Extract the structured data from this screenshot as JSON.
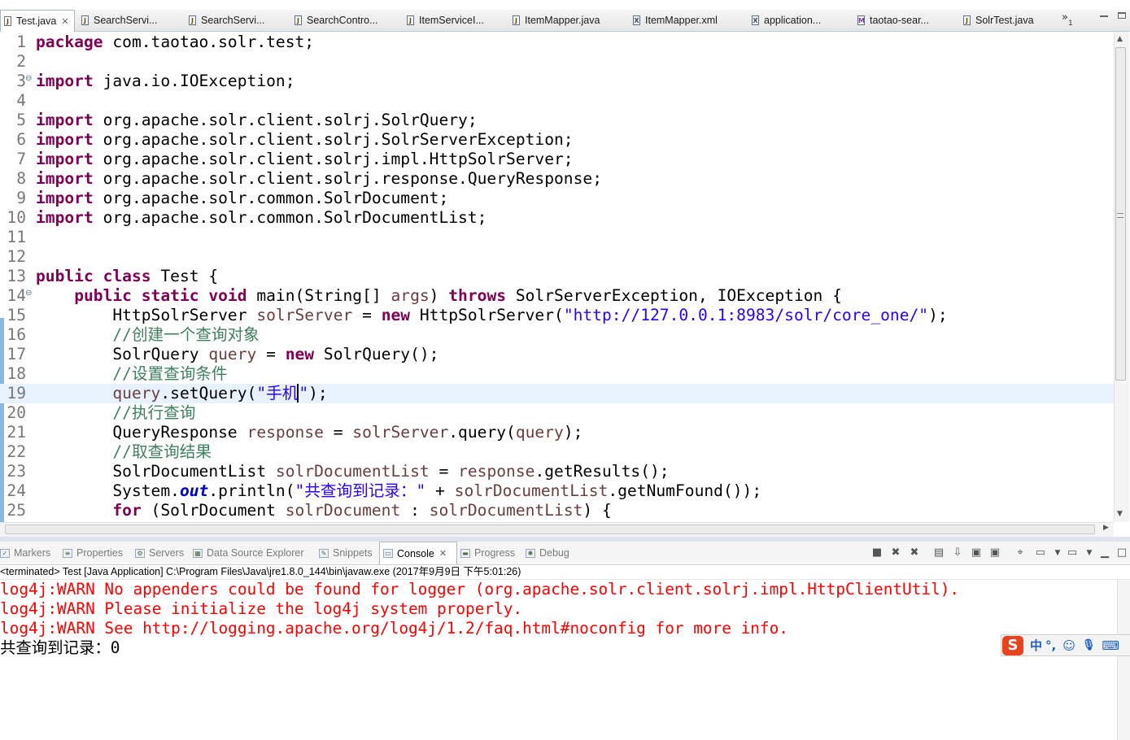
{
  "editor_tabs": [
    {
      "label": "Test.java",
      "icon": "J",
      "active": true
    },
    {
      "label": "SearchServi...",
      "icon": "J"
    },
    {
      "label": "SearchServi...",
      "icon": "J"
    },
    {
      "label": "SearchContro...",
      "icon": "J"
    },
    {
      "label": "ItemServiceI...",
      "icon": "J"
    },
    {
      "label": "ItemMapper.java",
      "icon": "J"
    },
    {
      "label": "ItemMapper.xml",
      "icon": "X"
    },
    {
      "label": "application...",
      "icon": "X"
    },
    {
      "label": "taotao-sear...",
      "icon": "M"
    },
    {
      "label": "SolrTest.java",
      "icon": "J"
    }
  ],
  "more_tabs": {
    "symbol": "»",
    "count": "1"
  },
  "code_lines": [
    {
      "n": "1",
      "tokens": [
        {
          "t": "package",
          "c": "kw"
        },
        {
          "t": " com.taotao.solr.test;"
        }
      ]
    },
    {
      "n": "2",
      "tokens": []
    },
    {
      "n": "3",
      "fold": true,
      "tokens": [
        {
          "t": "import",
          "c": "kw"
        },
        {
          "t": " java.io.IOException;"
        }
      ]
    },
    {
      "n": "4",
      "tokens": []
    },
    {
      "n": "5",
      "tokens": [
        {
          "t": "import",
          "c": "kw"
        },
        {
          "t": " org.apache.solr.client.solrj.SolrQuery;"
        }
      ]
    },
    {
      "n": "6",
      "tokens": [
        {
          "t": "import",
          "c": "kw"
        },
        {
          "t": " org.apache.solr.client.solrj.SolrServerException;"
        }
      ]
    },
    {
      "n": "7",
      "tokens": [
        {
          "t": "import",
          "c": "kw"
        },
        {
          "t": " org.apache.solr.client.solrj.impl.HttpSolrServer;"
        }
      ]
    },
    {
      "n": "8",
      "tokens": [
        {
          "t": "import",
          "c": "kw"
        },
        {
          "t": " org.apache.solr.client.solrj.response.QueryResponse;"
        }
      ]
    },
    {
      "n": "9",
      "tokens": [
        {
          "t": "import",
          "c": "kw"
        },
        {
          "t": " org.apache.solr.common.SolrDocument;"
        }
      ]
    },
    {
      "n": "10",
      "tokens": [
        {
          "t": "import",
          "c": "kw"
        },
        {
          "t": " org.apache.solr.common.SolrDocumentList;"
        }
      ]
    },
    {
      "n": "11",
      "tokens": []
    },
    {
      "n": "12",
      "tokens": []
    },
    {
      "n": "13",
      "tokens": [
        {
          "t": "public",
          "c": "kw"
        },
        {
          "t": " "
        },
        {
          "t": "class",
          "c": "kw"
        },
        {
          "t": " Test {"
        }
      ]
    },
    {
      "n": "14",
      "fold": true,
      "tokens": [
        {
          "t": "    "
        },
        {
          "t": "public",
          "c": "kw"
        },
        {
          "t": " "
        },
        {
          "t": "static",
          "c": "kw"
        },
        {
          "t": " "
        },
        {
          "t": "void",
          "c": "kw"
        },
        {
          "t": " main(String[] "
        },
        {
          "t": "args",
          "c": "var"
        },
        {
          "t": ") "
        },
        {
          "t": "throws",
          "c": "kw"
        },
        {
          "t": " SolrServerException, IOException {"
        }
      ]
    },
    {
      "n": "15",
      "tokens": [
        {
          "t": "        HttpSolrServer "
        },
        {
          "t": "solrServer",
          "c": "var"
        },
        {
          "t": " = "
        },
        {
          "t": "new",
          "c": "kw"
        },
        {
          "t": " HttpSolrServer("
        },
        {
          "t": "\"http://127.0.0.1:8983/solr/core_one/\"",
          "c": "str"
        },
        {
          "t": ");"
        }
      ]
    },
    {
      "n": "16",
      "tokens": [
        {
          "t": "        "
        },
        {
          "t": "//创建一个查询对象",
          "c": "com"
        }
      ]
    },
    {
      "n": "17",
      "tokens": [
        {
          "t": "        SolrQuery "
        },
        {
          "t": "query",
          "c": "var"
        },
        {
          "t": " = "
        },
        {
          "t": "new",
          "c": "kw"
        },
        {
          "t": " SolrQuery();"
        }
      ]
    },
    {
      "n": "18",
      "tokens": [
        {
          "t": "        "
        },
        {
          "t": "//设置查询条件",
          "c": "com"
        }
      ]
    },
    {
      "n": "19",
      "current": true,
      "tokens": [
        {
          "t": "        "
        },
        {
          "t": "query",
          "c": "var"
        },
        {
          "t": ".setQuery("
        },
        {
          "t": "\"手机",
          "c": "str"
        },
        {
          "t": "",
          "c": "cursor"
        },
        {
          "t": "\"",
          "c": "str"
        },
        {
          "t": ");"
        }
      ]
    },
    {
      "n": "20",
      "tokens": [
        {
          "t": "        "
        },
        {
          "t": "//执行查询",
          "c": "com"
        }
      ]
    },
    {
      "n": "21",
      "tokens": [
        {
          "t": "        QueryResponse "
        },
        {
          "t": "response",
          "c": "var"
        },
        {
          "t": " = "
        },
        {
          "t": "solrServer",
          "c": "var"
        },
        {
          "t": ".query("
        },
        {
          "t": "query",
          "c": "var"
        },
        {
          "t": ");"
        }
      ]
    },
    {
      "n": "22",
      "tokens": [
        {
          "t": "        "
        },
        {
          "t": "//取查询结果",
          "c": "com"
        }
      ]
    },
    {
      "n": "23",
      "tokens": [
        {
          "t": "        SolrDocumentList "
        },
        {
          "t": "solrDocumentList",
          "c": "var"
        },
        {
          "t": " = "
        },
        {
          "t": "response",
          "c": "var"
        },
        {
          "t": ".getResults();"
        }
      ]
    },
    {
      "n": "24",
      "tokens": [
        {
          "t": "        System."
        },
        {
          "t": "out",
          "c": "field"
        },
        {
          "t": ".println("
        },
        {
          "t": "\"共查询到记录：\"",
          "c": "str"
        },
        {
          "t": " + "
        },
        {
          "t": "solrDocumentList",
          "c": "var"
        },
        {
          "t": ".getNumFound());"
        }
      ]
    },
    {
      "n": "25",
      "tokens": [
        {
          "t": "        "
        },
        {
          "t": "for",
          "c": "kw"
        },
        {
          "t": " (SolrDocument "
        },
        {
          "t": "solrDocument",
          "c": "var"
        },
        {
          "t": " : "
        },
        {
          "t": "solrDocumentList",
          "c": "var"
        },
        {
          "t": ") {"
        }
      ]
    }
  ],
  "view_tabs": [
    {
      "label": "Markers",
      "icon": "markers-icon"
    },
    {
      "label": "Properties",
      "icon": "properties-icon"
    },
    {
      "label": "Servers",
      "icon": "servers-icon"
    },
    {
      "label": "Data Source Explorer",
      "icon": "data-source-icon"
    },
    {
      "label": "Snippets",
      "icon": "snippets-icon"
    },
    {
      "label": "Console",
      "icon": "console-icon",
      "active": true
    },
    {
      "label": "Progress",
      "icon": "progress-icon"
    },
    {
      "label": "Debug",
      "icon": "debug-icon"
    }
  ],
  "console": {
    "description": "<terminated> Test [Java Application] C:\\Program Files\\Java\\jre1.8.0_144\\bin\\javaw.exe (2017年9月9日 下午5:01:26)",
    "lines": [
      {
        "text": "log4j:WARN No appenders could be found for logger (org.apache.solr.client.solrj.impl.HttpClientUtil).",
        "type": "warn"
      },
      {
        "text": "log4j:WARN Please initialize the log4j system properly.",
        "type": "warn"
      },
      {
        "text": "log4j:WARN See http://logging.apache.org/log4j/1.2/faq.html#noconfig for more info.",
        "type": "warn"
      },
      {
        "text": "共查询到记录：0",
        "type": "out"
      }
    ]
  },
  "ime": {
    "logo": "S",
    "mode": "中",
    "punct": "°,",
    "emoji": "☺",
    "mic": "🎙",
    "keyboard": "⌨"
  },
  "colors": {
    "keyword": "#7f0055",
    "string": "#2a00ff",
    "comment": "#3f7f5f",
    "warn": "#ff0000",
    "current_line": "#e8f2fe"
  }
}
